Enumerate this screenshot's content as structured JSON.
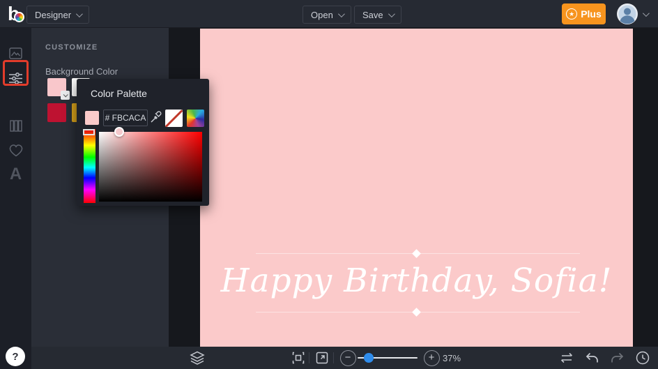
{
  "topbar": {
    "app_menu_label": "Designer",
    "open_label": "Open",
    "save_label": "Save",
    "plus_label": "Plus",
    "plus_color": "#F7941E"
  },
  "sidebar": {
    "items": [
      {
        "name": "photos",
        "icon": "image-icon"
      },
      {
        "name": "customize",
        "icon": "adjust-sliders-icon",
        "highlighted": true
      },
      {
        "name": "layouts",
        "icon": "columns-icon"
      },
      {
        "name": "favorites",
        "icon": "heart-icon"
      },
      {
        "name": "text",
        "icon": "text-icon"
      }
    ],
    "annotation_color": "#E23C2B"
  },
  "panel": {
    "title": "CUSTOMIZE",
    "section_label": "Background Color",
    "swatches": [
      {
        "name": "pink",
        "color": "#F9C7CB",
        "selected": true
      },
      {
        "name": "white",
        "color": "#FFFFFF"
      },
      {
        "name": "crimson",
        "color": "#BE1231"
      },
      {
        "name": "gold",
        "color": "#D9A21B"
      }
    ]
  },
  "color_palette": {
    "title": "Color Palette",
    "current_color": "#FBCACA",
    "hex_input_value": "# FBCACA"
  },
  "canvas": {
    "background_color": "#FBCACA",
    "text": "Happy Birthday, Sofia!",
    "text_color": "#FFFFFF"
  },
  "bottom_toolbar": {
    "zoom_level": "37%",
    "slider_color": "#2F8CEB"
  },
  "help_button": {
    "label": "?"
  }
}
